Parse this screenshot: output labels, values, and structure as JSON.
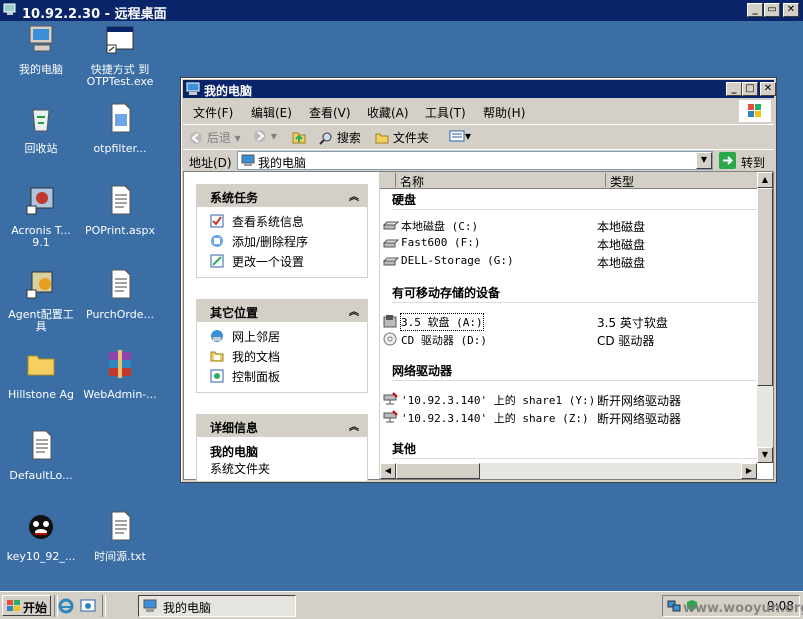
{
  "rdp": {
    "title": "10.92.2.30 - 远程桌面",
    "buttons": [
      "_",
      "▭",
      "✕"
    ]
  },
  "desktop": {
    "icons": [
      {
        "label": "我的电脑",
        "icon": "my-computer-icon"
      },
      {
        "label": "快捷方式 到",
        "label2": "OTPTest.exe",
        "icon": "exe-shortcut-icon"
      },
      {
        "label": "回收站",
        "icon": "recycle-bin-icon"
      },
      {
        "label": "otpfilter...",
        "icon": "document-icon"
      },
      {
        "label": "Acronis T...",
        "label2": "9.1",
        "icon": "acronis-icon"
      },
      {
        "label": "POPrint.aspx",
        "icon": "text-file-icon"
      },
      {
        "label": "Agent配置工",
        "label2": "具",
        "icon": "agent-config-icon"
      },
      {
        "label": "PurchOrde...",
        "icon": "text-file-icon"
      },
      {
        "label": "Hillstone Ag",
        "icon": "folder-icon"
      },
      {
        "label": "WebAdmin-...",
        "icon": "winrar-icon"
      },
      {
        "label": "DefaultLo...",
        "icon": "text-file-icon"
      },
      {
        "label": "key10_92_...",
        "icon": "key-cat-icon"
      },
      {
        "label": "时间源.txt",
        "icon": "text-file-icon"
      }
    ]
  },
  "explorer": {
    "title": "我的电脑",
    "menu": [
      "文件(F)",
      "编辑(E)",
      "查看(V)",
      "收藏(A)",
      "工具(T)",
      "帮助(H)"
    ],
    "toolbar": {
      "back": "后退",
      "search": "搜索",
      "folders": "文件夹"
    },
    "address": {
      "label": "地址(D)",
      "value": "我的电脑",
      "go": "转到"
    },
    "panels": {
      "system_tasks": {
        "title": "系统任务",
        "items": [
          "查看系统信息",
          "添加/删除程序",
          "更改一个设置"
        ]
      },
      "other_places": {
        "title": "其它位置",
        "items": [
          "网上邻居",
          "我的文档",
          "控制面板"
        ]
      },
      "details": {
        "title": "详细信息",
        "name": "我的电脑",
        "desc": "系统文件夹"
      }
    },
    "columns": {
      "name": "名称",
      "type": "类型"
    },
    "groups": {
      "hdd": {
        "title": "硬盘",
        "items": [
          {
            "name": "本地磁盘 (C:)",
            "type": "本地磁盘"
          },
          {
            "name": "Fast600 (F:)",
            "type": "本地磁盘"
          },
          {
            "name": "DELL-Storage (G:)",
            "type": "本地磁盘"
          }
        ]
      },
      "removable": {
        "title": "有可移动存储的设备",
        "items": [
          {
            "name": "3.5 软盘 (A:)",
            "type": "3.5 英寸软盘"
          },
          {
            "name": "CD 驱动器 (D:)",
            "type": "CD 驱动器"
          }
        ]
      },
      "network": {
        "title": "网络驱动器",
        "items": [
          {
            "name": "'10.92.3.140' 上的 share1 (Y:)",
            "type": "断开网络驱动器"
          },
          {
            "name": "'10.92.3.140' 上的 share (Z:)",
            "type": "断开网络驱动器"
          }
        ]
      },
      "other": {
        "title": "其他"
      }
    }
  },
  "taskbar": {
    "start": "开始",
    "task": "我的电脑",
    "clock": "9:08",
    "watermark": "www.wooyun.org"
  }
}
